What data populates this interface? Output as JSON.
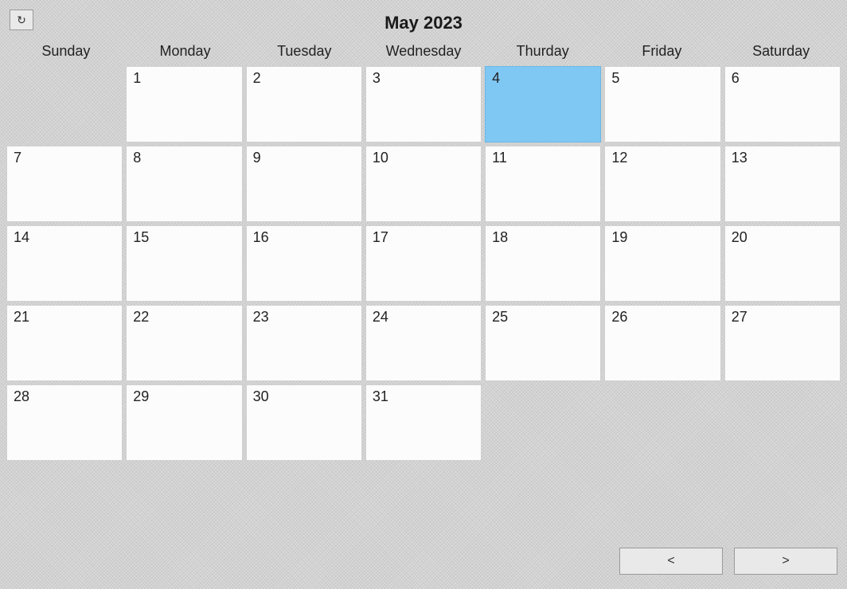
{
  "refresh_label": "↻",
  "title": "May 2023",
  "weekdays": [
    "Sunday",
    "Monday",
    "Tuesday",
    "Wednesday",
    "Thurday",
    "Friday",
    "Saturday"
  ],
  "leading_blanks": 1,
  "days_in_month": 31,
  "selected_day": 4,
  "nav": {
    "prev": "<",
    "next": ">"
  }
}
